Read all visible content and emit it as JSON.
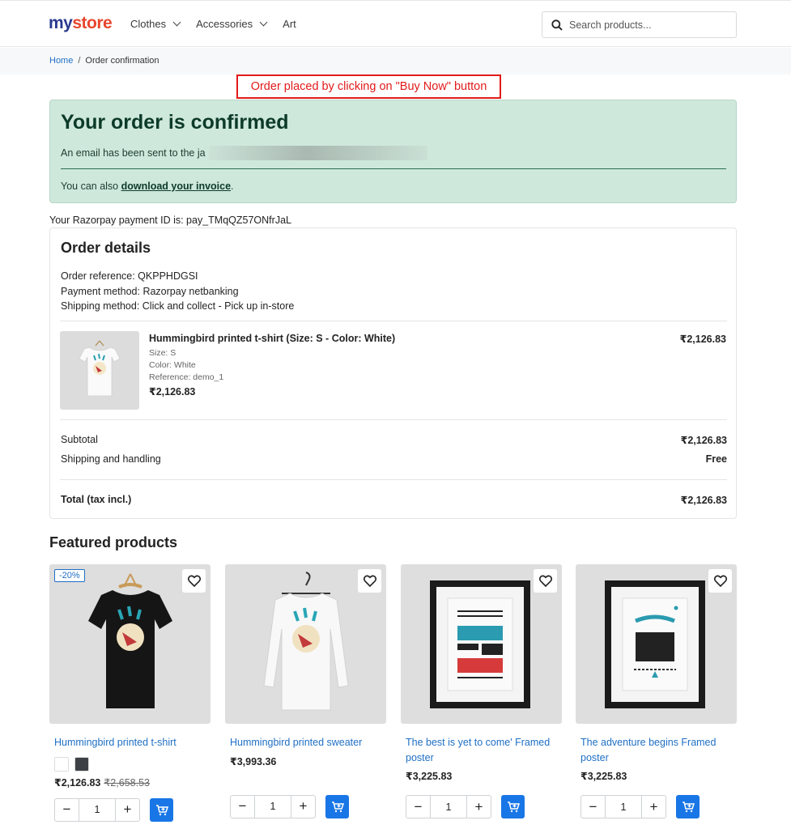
{
  "brand": {
    "logo_part1": "my",
    "logo_part2": "store"
  },
  "nav": {
    "items": [
      {
        "label": "Clothes"
      },
      {
        "label": "Accessories"
      },
      {
        "label": "Art"
      }
    ]
  },
  "search": {
    "placeholder": "Search products..."
  },
  "breadcrumb": {
    "home": "Home",
    "separator": "/",
    "current": "Order confirmation"
  },
  "annotation": {
    "text": "Order placed by clicking on \"Buy Now\" button"
  },
  "confirmation": {
    "title": "Your order is confirmed",
    "email_text": "An email has been sent to the ja",
    "invoice_prefix": "You can also ",
    "invoice_link": "download your invoice",
    "invoice_suffix": "."
  },
  "payment_id_text": "Your Razorpay payment ID is: pay_TMqQZ57ONfrJaL",
  "order_details": {
    "title": "Order details",
    "reference": "Order reference: QKPPHDGSI",
    "payment_method": "Payment method: Razorpay netbanking",
    "shipping_method": "Shipping method: Click and collect - Pick up in-store",
    "item": {
      "name": "Hummingbird printed t-shirt (Size: S - Color: White)",
      "size": "Size: S",
      "color": "Color: White",
      "reference": "Reference: demo_1",
      "unit_price": "₹2,126.83",
      "line_total": "₹2,126.83"
    },
    "subtotal_label": "Subtotal",
    "subtotal_value": "₹2,126.83",
    "shipping_label": "Shipping and handling",
    "shipping_value": "Free",
    "total_label": "Total (tax incl.)",
    "total_value": "₹2,126.83"
  },
  "featured": {
    "title": "Featured products",
    "products": [
      {
        "badge": "-20%",
        "name": "Hummingbird printed t-shirt",
        "price": "₹2,126.83",
        "old_price": "₹2,658.53",
        "qty": "1",
        "swatches": [
          "#ffffff",
          "#3d4145"
        ]
      },
      {
        "name": "Hummingbird printed sweater",
        "price": "₹3,993.36",
        "qty": "1"
      },
      {
        "name": "The best is yet to come' Framed poster",
        "price": "₹3,225.83",
        "qty": "1"
      },
      {
        "name": "The adventure begins Framed poster",
        "price": "₹3,225.83",
        "qty": "1"
      }
    ]
  },
  "colors": {
    "accent": "#1976e6",
    "link": "#1f6fc5",
    "success_bg": "#cfe8dc",
    "annotation": "#e21a1a"
  },
  "icons": {
    "search": "search-icon",
    "wishlist": "heart-icon",
    "cart": "add-to-cart-icon",
    "dropdown": "chevron-down-icon"
  }
}
